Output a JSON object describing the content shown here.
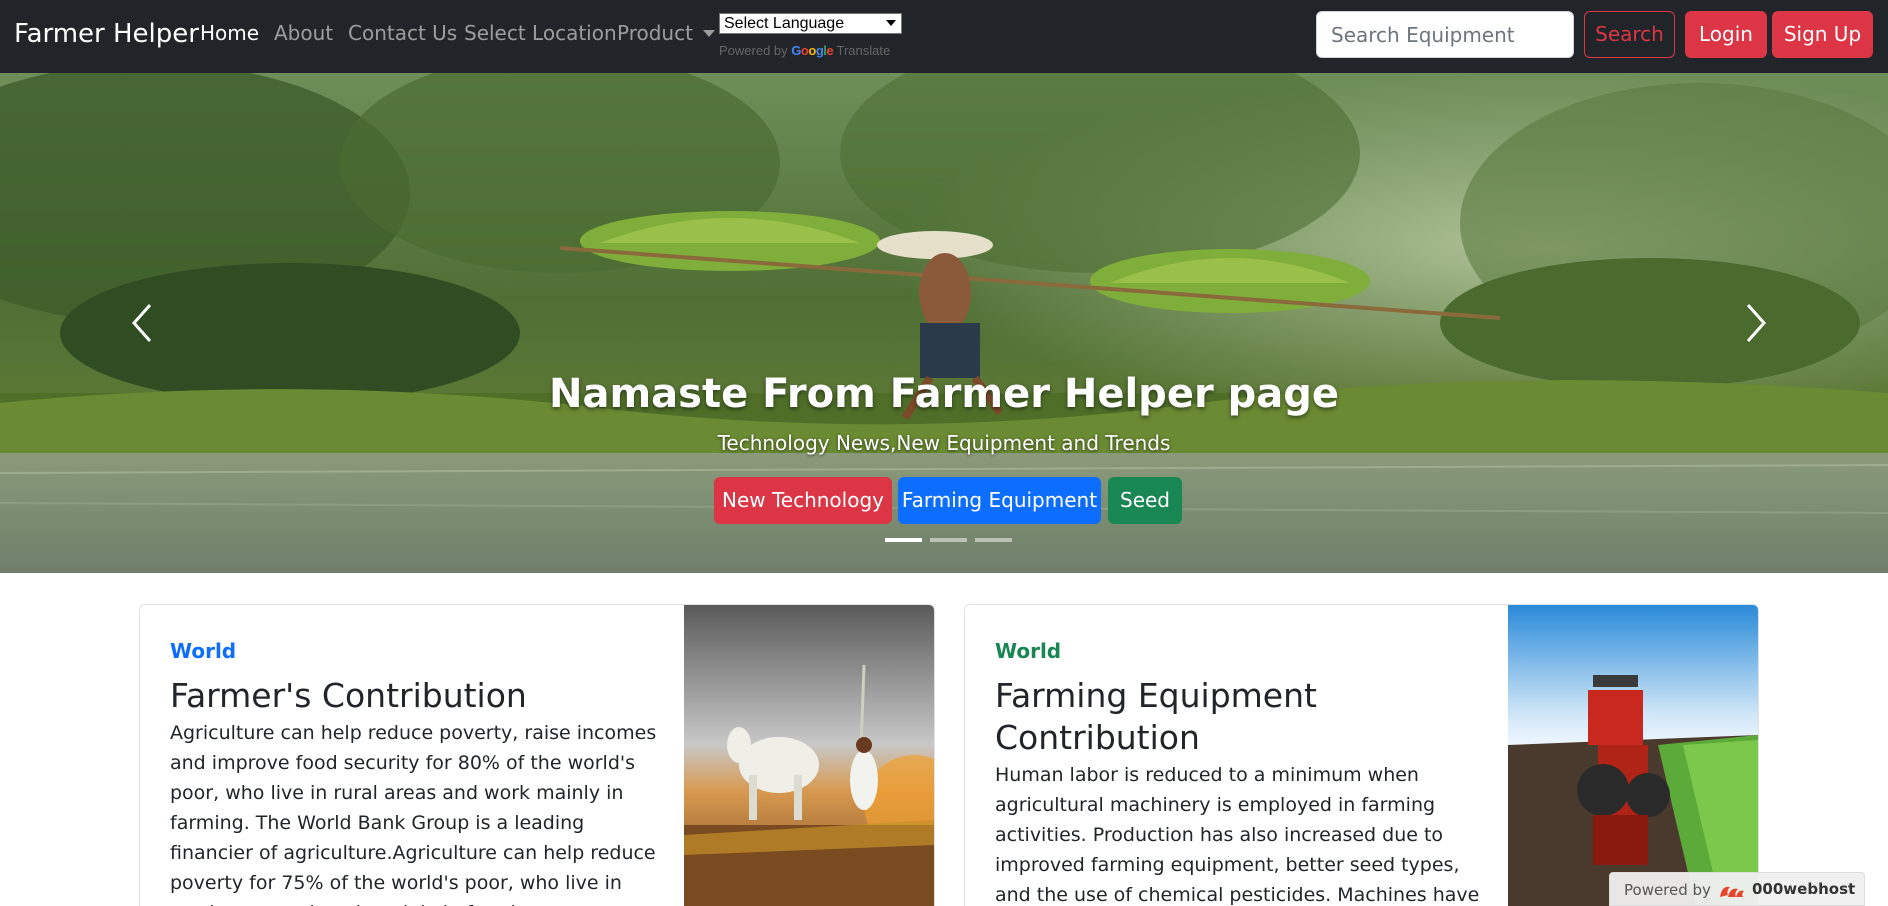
{
  "navbar": {
    "brand": "Farmer Helper",
    "links": [
      "Home",
      "About",
      "Contact Us",
      "Select Location",
      "Product"
    ],
    "language_select": "Select Language",
    "powered_by": "Powered by",
    "google": [
      "G",
      "o",
      "o",
      "g",
      "l",
      "e"
    ],
    "translate": "Translate",
    "search_placeholder": "Search Equipment",
    "search_button": "Search",
    "login_button": "Login",
    "signup_button": "Sign Up"
  },
  "hero": {
    "title": "Namaste From Farmer Helper page",
    "subtitle": "Technology News,New Equipment and Trends",
    "buttons": [
      "New Technology",
      "Farming Equipment",
      "Seed"
    ]
  },
  "cards": [
    {
      "category": "World",
      "title": "Farmer's Contribution",
      "text": "Agriculture can help reduce poverty, raise incomes and improve food security for 80% of the world's poor, who live in rural areas and work mainly in farming. The World Bank Group is a leading financier of agriculture.Agriculture can help reduce poverty for 75% of the world's poor, who live in rural areas and work mainly in farming."
    },
    {
      "category": "World",
      "title": "Farming Equipment Contribution",
      "text": "Human labor is reduced to a minimum when agricultural machinery is employed in farming activities. Production has also increased due to improved farming equipment, better seed types, and the use of chemical pesticides. Machines have helped"
    }
  ],
  "footer_badge": {
    "powered": "Powered by",
    "host": "000webhost"
  },
  "colors": {
    "navbar_bg": "#212529",
    "danger": "#dc3545",
    "primary": "#0d6efd",
    "success": "#198754"
  }
}
